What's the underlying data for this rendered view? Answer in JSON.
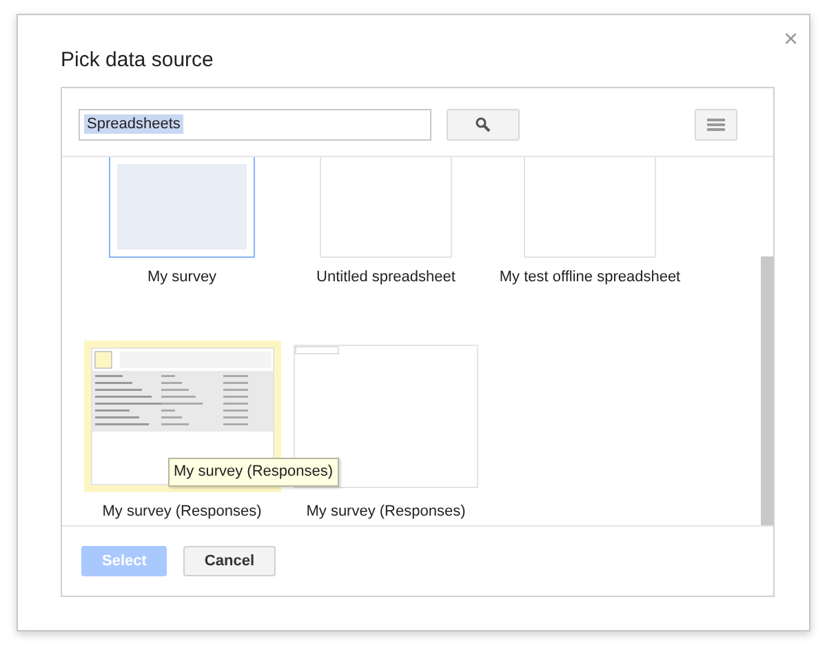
{
  "dialog": {
    "title": "Pick data source",
    "close": "×"
  },
  "search": {
    "value": "Spreadsheets",
    "value_highlighted": true
  },
  "rows": [
    [
      {
        "label": "My survey",
        "kind": "blank",
        "selected": true,
        "hovered": false
      },
      {
        "label": "Untitled spreadsheet",
        "kind": "blank",
        "selected": false,
        "hovered": false
      },
      {
        "label": "My test offline spreadsheet",
        "kind": "blank",
        "selected": false,
        "hovered": false
      }
    ],
    [
      {
        "label": "My survey (Responses)",
        "kind": "preview",
        "selected": false,
        "hovered": true,
        "tooltip": "My survey (Responses)"
      },
      {
        "label": "My survey (Responses)",
        "kind": "tab",
        "selected": false,
        "hovered": false
      }
    ]
  ],
  "buttons": [
    {
      "label": "Select",
      "kind": "primary",
      "disabled": true
    },
    {
      "label": "Cancel",
      "kind": "default",
      "disabled": false
    }
  ]
}
